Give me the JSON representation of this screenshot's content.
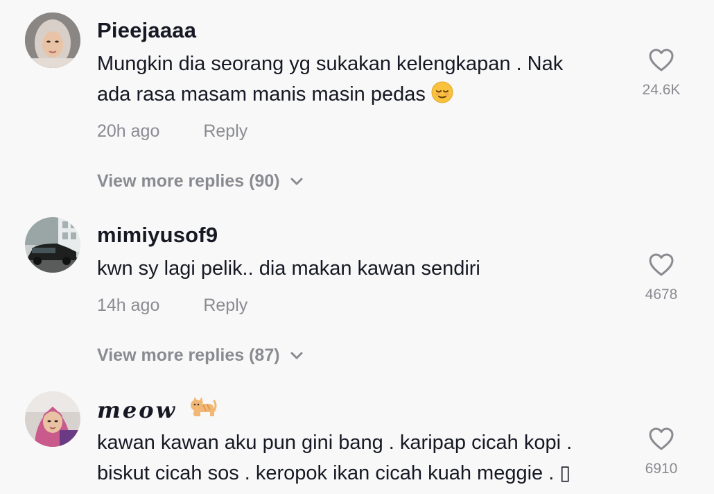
{
  "comments": [
    {
      "username": "Pieejaaaa",
      "text_line1": "Mungkin dia seorang yg sukakan kelengkapan . Nak",
      "text_line2": "ada rasa masam manis masin pedas",
      "emoji_icon": "relieved-face-emoji",
      "time": "20h ago",
      "reply_label": "Reply",
      "likes": "24.6K",
      "view_more": "View more replies (90)"
    },
    {
      "username": "mimiyusof9",
      "text_line1": "kwn sy lagi pelik.. dia makan kawan sendiri",
      "time": "14h ago",
      "reply_label": "Reply",
      "likes": "4678",
      "view_more": "View more replies (87)"
    },
    {
      "username": "meow",
      "username_icon": "cat-emoji",
      "text_line1": "kawan kawan aku pun gini bang . karipap cicah kopi .",
      "text_line2": "biskut cicah sos . keropok ikan cicah kuah meggie .",
      "trailing_glyph": "▯",
      "likes": "6910"
    }
  ],
  "colors": {
    "background": "#f8f8f8",
    "primary_text": "#161823",
    "secondary_text": "#8a8b91"
  }
}
